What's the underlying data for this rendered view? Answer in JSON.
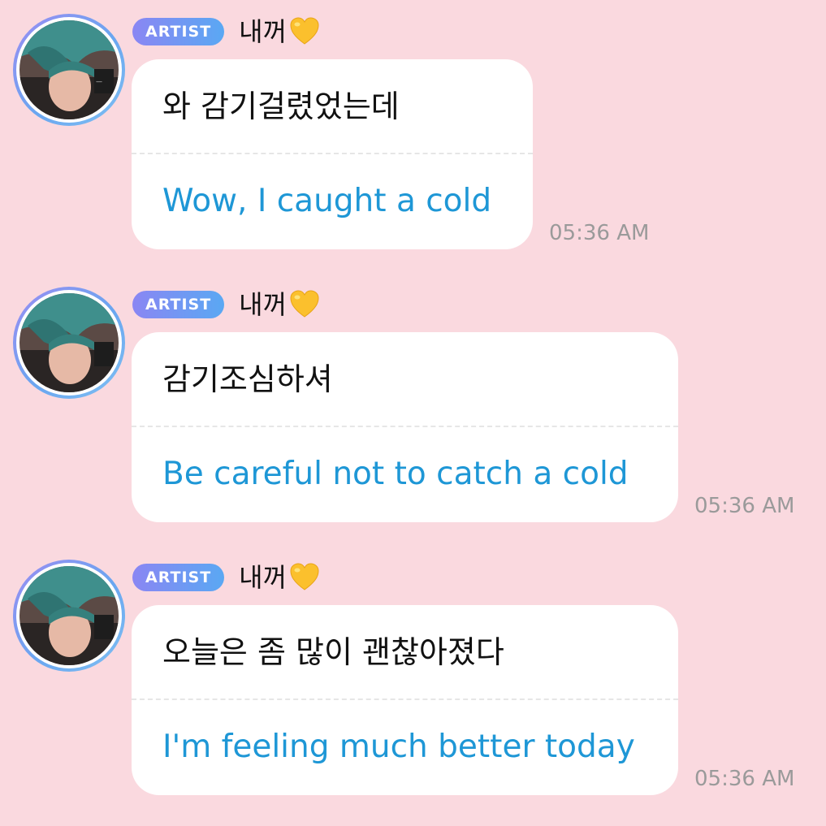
{
  "colors": {
    "background": "#fad9df",
    "bubble": "#ffffff",
    "translation": "#1e97d6",
    "timestamp": "#9a9a9a",
    "badge_start": "#8a86f3",
    "badge_end": "#5aa8f3"
  },
  "messages": [
    {
      "badge": "ARTIST",
      "sender": "내꺼",
      "icon": "yellow-heart-icon",
      "original": "와 감기걸렸었는데",
      "translation": "Wow, I caught a cold",
      "time": "05:36 AM"
    },
    {
      "badge": "ARTIST",
      "sender": "내꺼",
      "icon": "yellow-heart-icon",
      "original": "감기조심하셔",
      "translation": "Be careful not to catch a cold",
      "time": "05:36 AM"
    },
    {
      "badge": "ARTIST",
      "sender": "내꺼",
      "icon": "yellow-heart-icon",
      "original": "오늘은 좀 많이 괜찮아졌다",
      "translation": "I'm feeling much better today",
      "time": "05:36 AM"
    }
  ]
}
